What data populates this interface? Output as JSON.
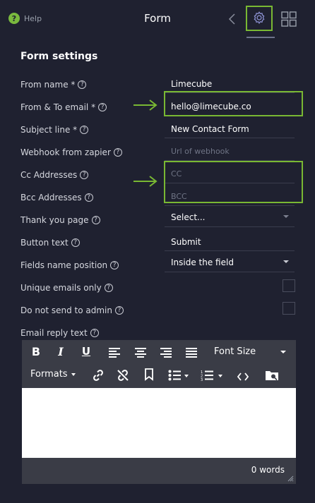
{
  "header": {
    "help_label": "Help",
    "title": "Form",
    "help_icon_glyph": "?",
    "icons": [
      "chevron-left-icon",
      "gear-icon",
      "grid-icon"
    ]
  },
  "settings": {
    "title": "Form settings",
    "fields": [
      {
        "label": "From name *",
        "value": "Limecube",
        "placeholder": ""
      },
      {
        "label": "From & To email *",
        "value": "hello@limecube.co",
        "placeholder": ""
      },
      {
        "label": "Subject line *",
        "value": "New Contact Form",
        "placeholder": ""
      },
      {
        "label": "Webhook from zapier",
        "value": "",
        "placeholder": "Url of webhook"
      },
      {
        "label": "Cc Addresses",
        "value": "",
        "placeholder": "CC"
      },
      {
        "label": "Bcc Addresses",
        "value": "",
        "placeholder": "BCC"
      },
      {
        "label": "Thank you page",
        "value": "Select...",
        "placeholder": ""
      },
      {
        "label": "Button text",
        "value": "Submit",
        "placeholder": ""
      },
      {
        "label": "Fields name position",
        "value": "Inside the field",
        "placeholder": ""
      },
      {
        "label": "Unique emails only",
        "value": "",
        "placeholder": ""
      },
      {
        "label": "Do not send to admin",
        "value": "",
        "placeholder": ""
      },
      {
        "label": "Email reply text",
        "value": "",
        "placeholder": ""
      }
    ],
    "question_glyph": "?"
  },
  "editor": {
    "toolbar_row1": [
      "bold-icon",
      "italic-icon",
      "underline-icon",
      "align-left-icon",
      "align-center-icon",
      "align-right-icon",
      "justify-icon"
    ],
    "font_size_label": "Font Size",
    "formats_label": "Formats",
    "toolbar_row2": [
      "link-icon",
      "unlink-icon",
      "bookmark-icon",
      "bullet-list-icon",
      "numbered-list-icon",
      "code-icon",
      "media-icon"
    ],
    "word_count": "0 words",
    "content": ""
  },
  "colors": {
    "background": "#1f2130",
    "highlight": "#79b833",
    "help_green": "#7ab93e"
  }
}
